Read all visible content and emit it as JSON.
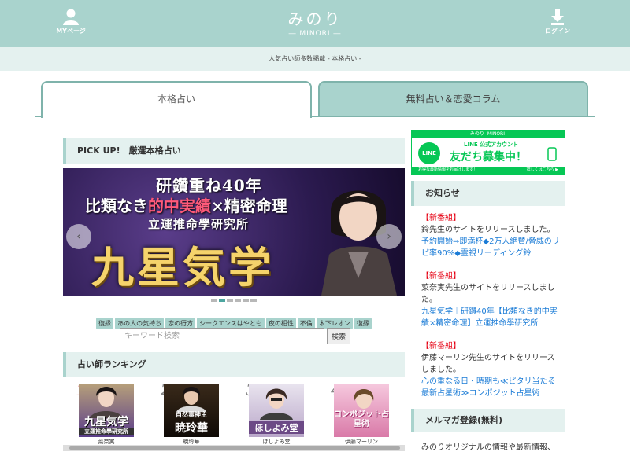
{
  "header": {
    "logo_main": "みのり",
    "logo_sub": "― MINORI ―",
    "mypage_label": "MYページ",
    "login_label": "ログイン",
    "tagline": "人気占い師多数掲載 - 本格占い -"
  },
  "tabs": [
    {
      "label": "本格占い",
      "active": true
    },
    {
      "label": "無料占い＆恋愛コラム",
      "active": false
    }
  ],
  "pickup": {
    "heading": "PICK UP!　厳選本格占い",
    "banner": {
      "line1": "研鑽重ね40年",
      "line2_a": "比類なき",
      "line2_b": "的中実績",
      "line2_c": "×精密命理",
      "line3": "立運推命學研究所",
      "line4": "九星気学"
    },
    "prev_label": "‹",
    "next_label": "›",
    "slide_count": 6,
    "active_slide": 1
  },
  "tags": [
    "復縁",
    "あの人の気持ち",
    "恋の行方",
    "シークエンスはやとも",
    "夜の相性",
    "不倫",
    "木下レオン",
    "復縁"
  ],
  "search": {
    "placeholder": "キーワード検索",
    "button_label": "検索"
  },
  "ranking": {
    "heading": "占い師ランキング",
    "items": [
      {
        "rank": "1",
        "name": "菜奈実",
        "caption_main": "九星気学",
        "caption_sub": "立運推命學研究所"
      },
      {
        "rank": "2",
        "name": "暁玲華",
        "caption_main": "暁玲華",
        "caption_sub": "自然霊神主"
      },
      {
        "rank": "3",
        "name": "ほしよみ堂",
        "caption_main": "ほしよみ堂",
        "caption_sub": ""
      },
      {
        "rank": "4",
        "name": "伊藤マーリン",
        "caption_main": "コンポジット占星術",
        "caption_sub": ""
      }
    ]
  },
  "line_banner": {
    "top_text": "みのり -MINORI-",
    "sub": "LINE 公式アカウント",
    "main": "友だち募集中！",
    "icon_label": "LINE",
    "bottom_left": "お得な最新情報をお届けします！",
    "bottom_right": "詳しくはこちら ▶"
  },
  "sidebar": {
    "news_heading": "お知らせ",
    "news": [
      {
        "badge": "【新番組】",
        "text": "鈴先生のサイトをリリースしました。",
        "link": "予約開始⇒即満杯◆2万人絶賛/脅威のリピ率90%◆霊視リーディング鈴"
      },
      {
        "badge": "【新番組】",
        "text": "菜奈実先生のサイトをリリースしました。",
        "link": "九星気学｜研鑽40年【比類なき的中実績×精密命理】立運推命學研究所"
      },
      {
        "badge": "【新番組】",
        "text": "伊藤マーリン先生のサイトをリリースしました。",
        "link": "心の重なる日・時期も≪ピタリ当たる最新占星術≫コンポジット占星術"
      }
    ],
    "mailmag_heading": "メルマガ登録(無料)",
    "mailmag_text": "みのりオリジナルの情報や最新情報、"
  },
  "colors": {
    "header_bg": "#a9d3cd",
    "accent": "#7fb3ab",
    "news_badge": "#e60012",
    "link": "#1a7bd6",
    "line_green": "#06c755"
  }
}
